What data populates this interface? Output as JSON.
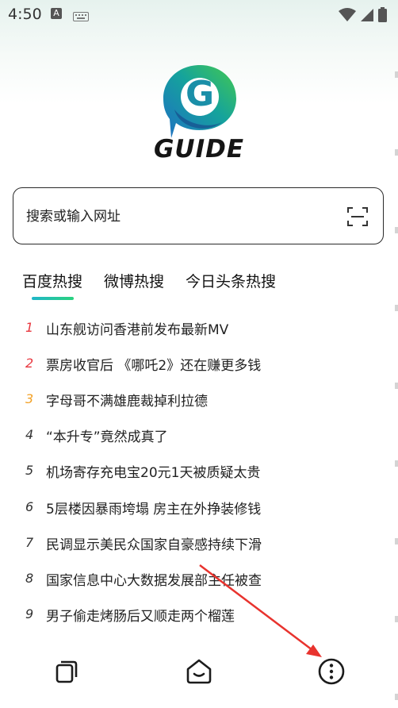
{
  "status_bar": {
    "time": "4:50",
    "notification_letter": "A",
    "icons": [
      "keyboard-icon",
      "wifi-icon",
      "signal-icon",
      "battery-icon"
    ]
  },
  "logo": {
    "letter": "G",
    "text": "GUIDE",
    "colors": {
      "blue": "#1f78c8",
      "teal": "#15a39c",
      "green": "#3fc45f"
    }
  },
  "search": {
    "placeholder": "搜索或输入网址"
  },
  "tabs": [
    {
      "label": "百度热搜",
      "active": true
    },
    {
      "label": "微博热搜",
      "active": false
    },
    {
      "label": "今日头条热搜",
      "active": false
    }
  ],
  "hot_list": [
    {
      "rank": "1",
      "title": "山东舰访问香港前发布最新MV",
      "color": "#e8373f"
    },
    {
      "rank": "2",
      "title": "票房收官后 《哪吒2》还在赚更多钱",
      "color": "#e8373f"
    },
    {
      "rank": "3",
      "title": "字母哥不满雄鹿裁掉利拉德",
      "color": "#f2a024"
    },
    {
      "rank": "4",
      "title": "“本升专”竟然成真了",
      "color": "#333333"
    },
    {
      "rank": "5",
      "title": "机场寄存充电宝20元1天被质疑太贵",
      "color": "#333333"
    },
    {
      "rank": "6",
      "title": "5层楼因暴雨垮塌 房主在外挣装修钱",
      "color": "#333333"
    },
    {
      "rank": "7",
      "title": "民调显示美民众国家自豪感持续下滑",
      "color": "#333333"
    },
    {
      "rank": "8",
      "title": "国家信息中心大数据发展部主任被查",
      "color": "#333333"
    },
    {
      "rank": "9",
      "title": "男子偷走烤肠后又顺走两个榴莲",
      "color": "#333333"
    }
  ],
  "bottom_bar": {
    "items": [
      "tabs-icon",
      "home-icon",
      "more-icon"
    ]
  },
  "annotation": {
    "arrow_color": "#e8332e"
  }
}
